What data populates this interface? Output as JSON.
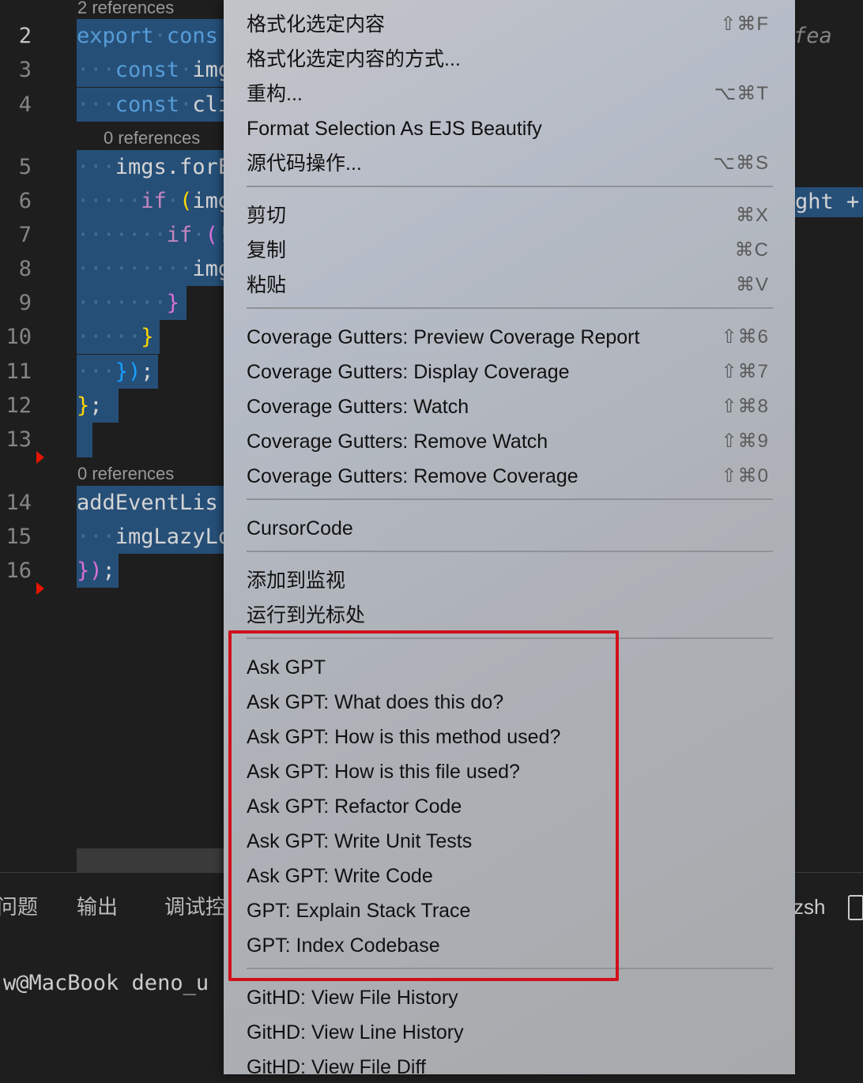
{
  "editor": {
    "ref_hints": [
      "2 references",
      "0 references",
      "0 references"
    ],
    "line_numbers": [
      "2",
      "3",
      "4",
      "5",
      "6",
      "7",
      "8",
      "9",
      "10",
      "11",
      "12",
      "13",
      "14",
      "15",
      "16"
    ],
    "lines": {
      "l2": [
        "export",
        "cons"
      ],
      "l3": [
        "const",
        "img"
      ],
      "l4": [
        "const",
        "cli"
      ],
      "l5": [
        "imgs.forE"
      ],
      "l6": [
        "if",
        "(",
        "img"
      ],
      "l7": [
        "if",
        "(",
        "!"
      ],
      "l8": [
        "img"
      ],
      "l9": [
        "}"
      ],
      "l10": [
        "}"
      ],
      "l11": [
        "})",
        ";"
      ],
      "l12": [
        "}",
        ";"
      ],
      "l14": [
        "addEventLis"
      ],
      "l15": [
        "imgLazyLo"
      ],
      "l16": [
        "})",
        ";"
      ]
    },
    "right_fragment": "ght +",
    "right_italic": "fea"
  },
  "panel": {
    "tabs": [
      "问题",
      "输出",
      "调试控"
    ],
    "terminal_shell": "zsh",
    "terminal_line": "w@MacBook deno_u"
  },
  "menu": {
    "groups": [
      [
        {
          "label": "格式化选定内容",
          "shortcut": "⇧⌘F"
        },
        {
          "label": "格式化选定内容的方式...",
          "shortcut": ""
        },
        {
          "label": "重构...",
          "shortcut": "⌥⌘T"
        },
        {
          "label": "Format Selection As EJS Beautify",
          "shortcut": ""
        },
        {
          "label": "源代码操作...",
          "shortcut": "⌥⌘S"
        }
      ],
      [
        {
          "label": "剪切",
          "shortcut": "⌘X"
        },
        {
          "label": "复制",
          "shortcut": "⌘C"
        },
        {
          "label": "粘贴",
          "shortcut": "⌘V"
        }
      ],
      [
        {
          "label": "Coverage Gutters: Preview Coverage Report",
          "shortcut": "⇧⌘6"
        },
        {
          "label": "Coverage Gutters: Display Coverage",
          "shortcut": "⇧⌘7"
        },
        {
          "label": "Coverage Gutters: Watch",
          "shortcut": "⇧⌘8"
        },
        {
          "label": "Coverage Gutters: Remove Watch",
          "shortcut": "⇧⌘9"
        },
        {
          "label": "Coverage Gutters: Remove Coverage",
          "shortcut": "⇧⌘0"
        }
      ],
      [
        {
          "label": "CursorCode",
          "shortcut": ""
        }
      ],
      [
        {
          "label": "添加到监视",
          "shortcut": ""
        },
        {
          "label": "运行到光标处",
          "shortcut": ""
        }
      ],
      [
        {
          "label": "Ask GPT",
          "shortcut": ""
        },
        {
          "label": "Ask GPT: What does this do?",
          "shortcut": ""
        },
        {
          "label": "Ask GPT: How is this method used?",
          "shortcut": ""
        },
        {
          "label": "Ask GPT: How is this file used?",
          "shortcut": ""
        },
        {
          "label": "Ask GPT: Refactor Code",
          "shortcut": ""
        },
        {
          "label": "Ask GPT: Write Unit Tests",
          "shortcut": ""
        },
        {
          "label": "Ask GPT: Write Code",
          "shortcut": ""
        },
        {
          "label": "GPT: Explain Stack Trace",
          "shortcut": ""
        },
        {
          "label": "GPT: Index Codebase",
          "shortcut": ""
        }
      ],
      [
        {
          "label": "GitHD: View File History",
          "shortcut": ""
        },
        {
          "label": "GitHD: View Line History",
          "shortcut": ""
        },
        {
          "label": "GitHD: View File Diff",
          "shortcut": ""
        }
      ]
    ]
  },
  "colors": {
    "highlight_box": "#d0101b",
    "selection": "#264f78",
    "editor_bg": "#1e1e1e"
  }
}
